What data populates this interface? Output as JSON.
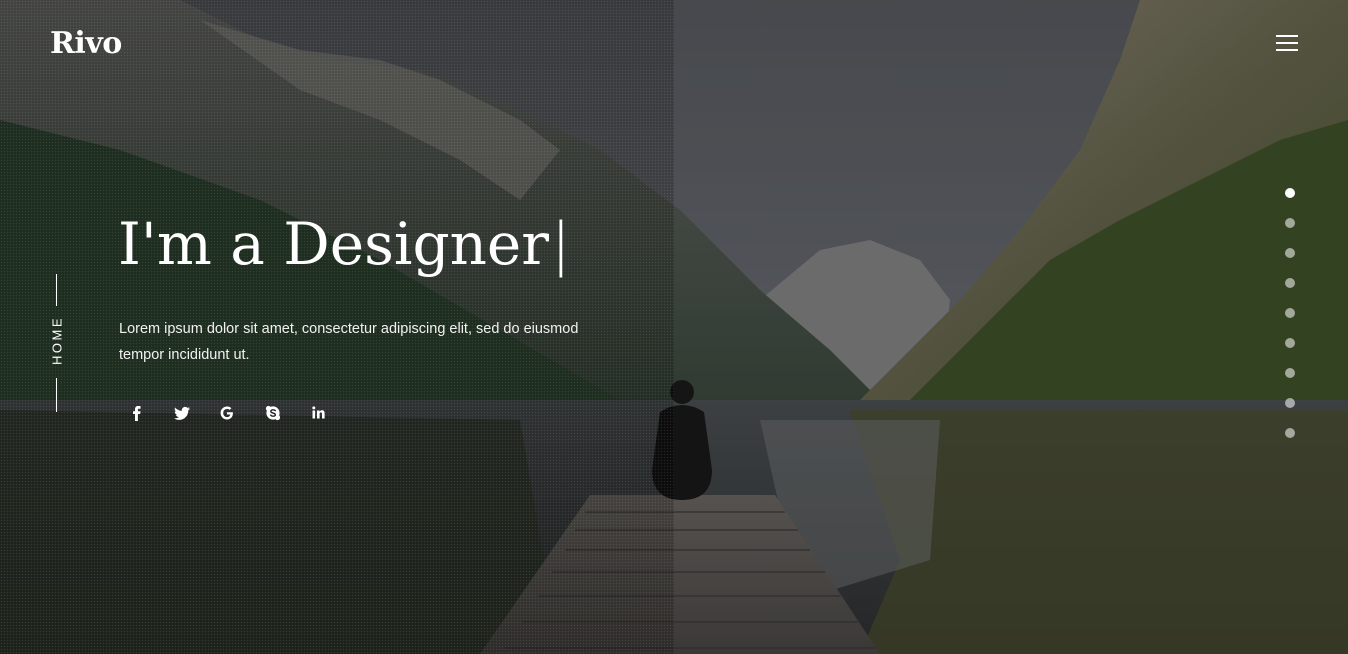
{
  "brand": {
    "logo_text": "Rivo"
  },
  "header": {
    "menu_icon": "hamburger-menu-icon"
  },
  "side_nav": {
    "label": "HOME"
  },
  "hero": {
    "headline": "I'm a Designer",
    "cursor": "|",
    "description": "Lorem ipsum dolor sit amet, consectetur adipiscing elit, sed do eiusmod tempor incididunt ut."
  },
  "socials": [
    {
      "name": "facebook",
      "icon": "facebook-icon"
    },
    {
      "name": "twitter",
      "icon": "twitter-icon"
    },
    {
      "name": "google",
      "icon": "google-icon"
    },
    {
      "name": "skype",
      "icon": "skype-icon"
    },
    {
      "name": "linkedin",
      "icon": "linkedin-icon"
    }
  ],
  "slider": {
    "dot_count": 9,
    "active_index": 0
  },
  "colors": {
    "text": "#ffffff",
    "overlay": "#000000",
    "dot_inactive": "#bfbfbf"
  }
}
